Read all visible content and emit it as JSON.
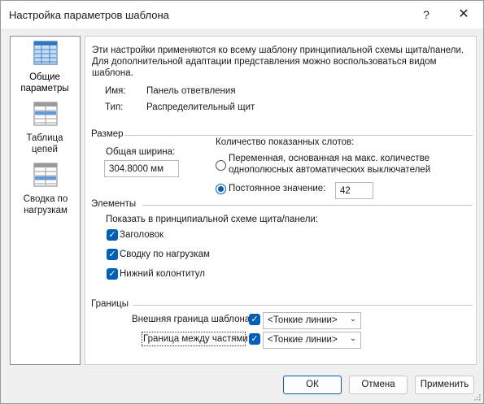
{
  "window": {
    "title": "Настройка параметров шаблона",
    "help_glyph": "?",
    "close_glyph": "✕"
  },
  "sidebar": {
    "items": [
      {
        "label": "Общие параметры",
        "icon": "grid-table-icon",
        "selected": true
      },
      {
        "label": "Таблица цепей",
        "icon": "circuit-table-icon",
        "selected": false
      },
      {
        "label": "Сводка по нагрузкам",
        "icon": "load-summary-icon",
        "selected": false
      }
    ]
  },
  "general": {
    "description": "Эти настройки применяются ко всему шаблону принципиальной схемы щита/панели. Для дополнительной адаптации представления можно воспользоваться видом шаблона.",
    "name_label": "Имя:",
    "name_value": "Панель ответвления",
    "type_label": "Тип:",
    "type_value": "Распределительный щит"
  },
  "size_group": {
    "title": "Размер",
    "total_width_label": "Общая ширина:",
    "total_width_value": "304.8000 мм",
    "slots_label": "Количество показанных слотов:",
    "radio_variable_label": "Переменная, основанная на макс. количестве однополюсных автоматических выключателей",
    "radio_variable_selected": false,
    "radio_fixed_label": "Постоянное значение:",
    "radio_fixed_selected": true,
    "fixed_value": "42"
  },
  "elements_group": {
    "title": "Элементы",
    "show_label": "Показать в принципиальной схеме щита/панели:",
    "checkboxes": [
      {
        "label": "Заголовок",
        "checked": true
      },
      {
        "label": "Сводку по нагрузкам",
        "checked": true
      },
      {
        "label": "Нижний колонтитул",
        "checked": true
      }
    ]
  },
  "borders_group": {
    "title": "Границы",
    "outer_label": "Внешняя граница шаблона:",
    "outer_checked": true,
    "outer_value": "<Тонкие линии>",
    "between_label": "Граница между частями:",
    "between_checked": true,
    "between_value": "<Тонкие линии>"
  },
  "footer": {
    "ok_label": "ОК",
    "cancel_label": "Отмена",
    "apply_label": "Применить"
  },
  "colors": {
    "accent": "#005fb8",
    "background": "#f0f0f0"
  }
}
